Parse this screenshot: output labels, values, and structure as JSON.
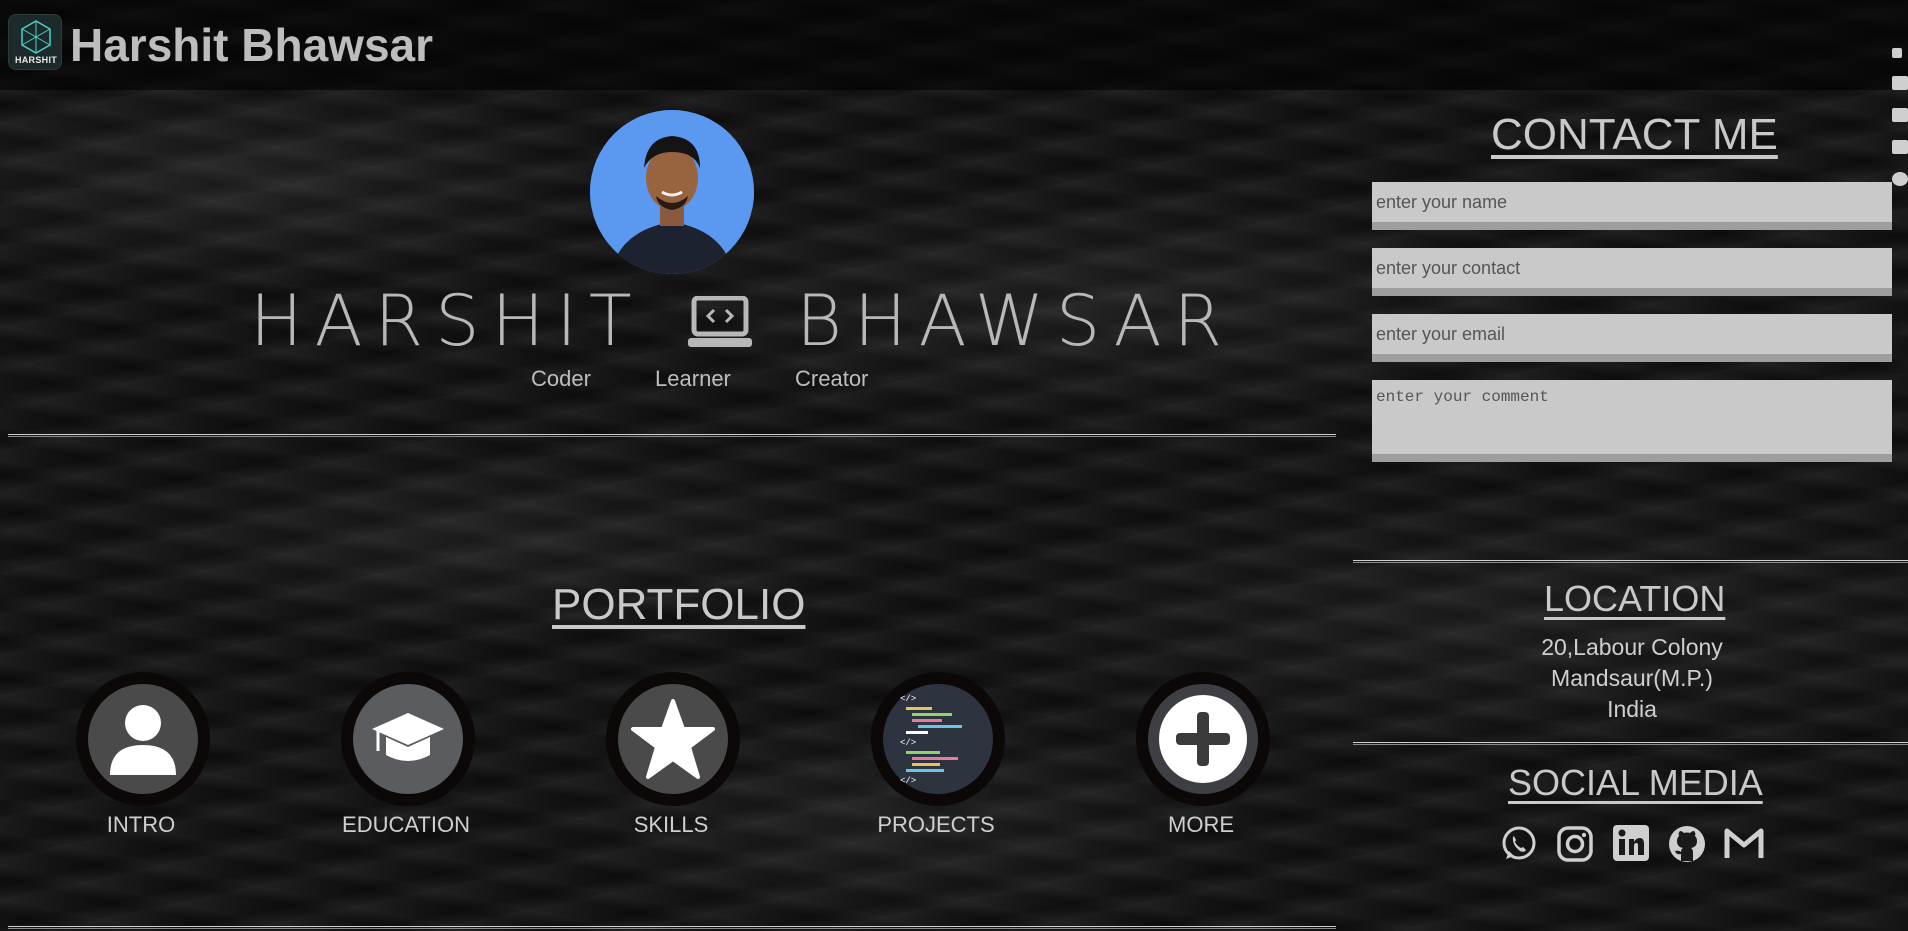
{
  "header": {
    "logo_text": "HARSHIT",
    "title": "Harshit Bhawsar"
  },
  "hero": {
    "name_first": "HARSHIT",
    "name_last": "BHAWSAR",
    "taglines": [
      "Coder",
      "Learner",
      "Creator"
    ]
  },
  "portfolio": {
    "title": "PORTFOLIO",
    "items": [
      {
        "label": "INTRO",
        "icon": "user-icon"
      },
      {
        "label": "EDUCATION",
        "icon": "graduation-cap-icon"
      },
      {
        "label": "SKILLS",
        "icon": "star-icon"
      },
      {
        "label": "PROJECTS",
        "icon": "code-icon"
      },
      {
        "label": "MORE",
        "icon": "plus-icon"
      }
    ]
  },
  "contact": {
    "title": "CONTACT ME",
    "name_placeholder": "enter your name",
    "contact_placeholder": "enter your contact",
    "email_placeholder": "enter your email",
    "comment_placeholder": "enter your comment"
  },
  "location": {
    "title": "LOCATION",
    "line1": "20,Labour Colony",
    "line2": "Mandsaur(M.P.)",
    "line3": "India"
  },
  "social": {
    "title": "SOCIAL MEDIA",
    "icons": [
      "whatsapp-icon",
      "instagram-icon",
      "linkedin-icon",
      "github-icon",
      "gmail-icon"
    ]
  }
}
